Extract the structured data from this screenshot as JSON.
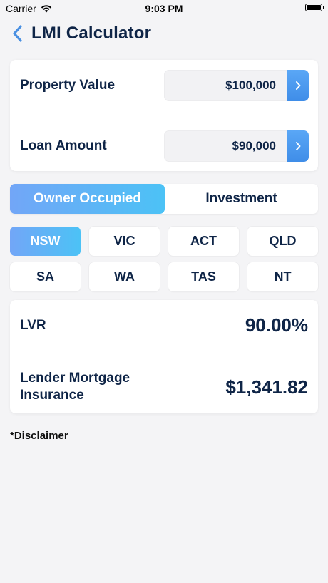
{
  "status": {
    "carrier": "Carrier",
    "time": "9:03 PM"
  },
  "nav": {
    "title": "LMI Calculator"
  },
  "inputs": {
    "property_value_label": "Property Value",
    "property_value": "$100,000",
    "loan_amount_label": "Loan Amount",
    "loan_amount": "$90,000"
  },
  "occupancy": {
    "options": [
      "Owner Occupied",
      "Investment"
    ],
    "selected": "Owner Occupied"
  },
  "states": {
    "items": [
      "NSW",
      "VIC",
      "ACT",
      "QLD",
      "SA",
      "WA",
      "TAS",
      "NT"
    ],
    "selected": "NSW"
  },
  "results": {
    "lvr_label": "LVR",
    "lvr_value": "90.00%",
    "lmi_label_line1": "Lender Mortgage",
    "lmi_label_line2": "Insurance",
    "lmi_value": "$1,341.82"
  },
  "footer": {
    "disclaimer": "*Disclaimer"
  },
  "colors": {
    "accent_start": "#72a6f7",
    "accent_end": "#4cc2f6",
    "arrow_button": "#4a97ee",
    "text_primary": "#0f2547",
    "back_chevron": "#4a90e2"
  },
  "icons": {
    "back": "chevron-left-icon",
    "field_arrow": "chevron-right-icon",
    "wifi": "wifi-icon",
    "battery": "battery-icon"
  }
}
